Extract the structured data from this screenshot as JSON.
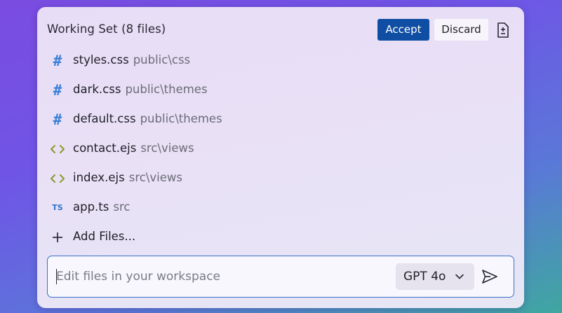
{
  "header": {
    "title": "Working Set (8 files)",
    "accept_label": "Accept",
    "discard_label": "Discard",
    "diff_icon": "file-diff-icon"
  },
  "files": [
    {
      "icon": "hash-icon",
      "icon_text": "#",
      "name": "styles.css",
      "dir": "public\\css"
    },
    {
      "icon": "hash-icon",
      "icon_text": "#",
      "name": "dark.css",
      "dir": "public\\themes"
    },
    {
      "icon": "hash-icon",
      "icon_text": "#",
      "name": "default.css",
      "dir": "public\\themes"
    },
    {
      "icon": "code-brackets-icon",
      "icon_text": "",
      "name": "contact.ejs",
      "dir": "src\\views"
    },
    {
      "icon": "code-brackets-icon",
      "icon_text": "",
      "name": "index.ejs",
      "dir": "src\\views"
    },
    {
      "icon": "typescript-icon",
      "icon_text": "TS",
      "name": "app.ts",
      "dir": "src"
    }
  ],
  "add_files": {
    "icon": "plus-icon",
    "label": "Add Files..."
  },
  "input": {
    "placeholder": "Edit files in your workspace",
    "value": ""
  },
  "model": {
    "selected": "GPT 4o",
    "chevron_icon": "chevron-down-icon"
  },
  "send_icon": "send-icon",
  "colors": {
    "accent": "#0f4ea3",
    "css_icon": "#3a7fd6",
    "ejs_icon": "#8a9a2b",
    "ts_icon": "#2f74c8",
    "input_border": "#3a6fc7"
  }
}
